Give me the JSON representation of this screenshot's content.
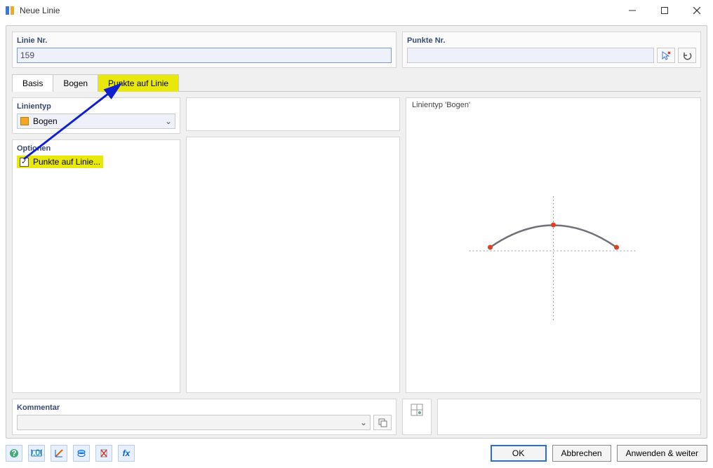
{
  "window": {
    "title": "Neue Linie"
  },
  "groups": {
    "linie_nr_label": "Linie Nr.",
    "linie_nr_value": "159",
    "punkte_nr_label": "Punkte Nr."
  },
  "tabs": {
    "basis": "Basis",
    "bogen": "Bogen",
    "punkte_auf_linie": "Punkte auf Linie"
  },
  "left": {
    "linientyp_label": "Linientyp",
    "linientyp_value": "Bogen",
    "optionen_label": "Optionen",
    "punkte_auf_linie_chk": "Punkte auf Linie..."
  },
  "preview": {
    "heading": "Linientyp 'Bogen'"
  },
  "kommentar": {
    "label": "Kommentar"
  },
  "buttons": {
    "ok": "OK",
    "abbrechen": "Abbrechen",
    "anwenden": "Anwenden & weiter"
  },
  "icons": {
    "search_cursor": "search-cursor-icon",
    "undo": "undo-icon",
    "copy": "copy-icon",
    "grid": "grid-icon",
    "help": "help-icon",
    "units": "units-icon",
    "measure": "measure-icon",
    "layer": "layer-icon",
    "delete": "delete-icon",
    "fx": "fx-icon"
  }
}
